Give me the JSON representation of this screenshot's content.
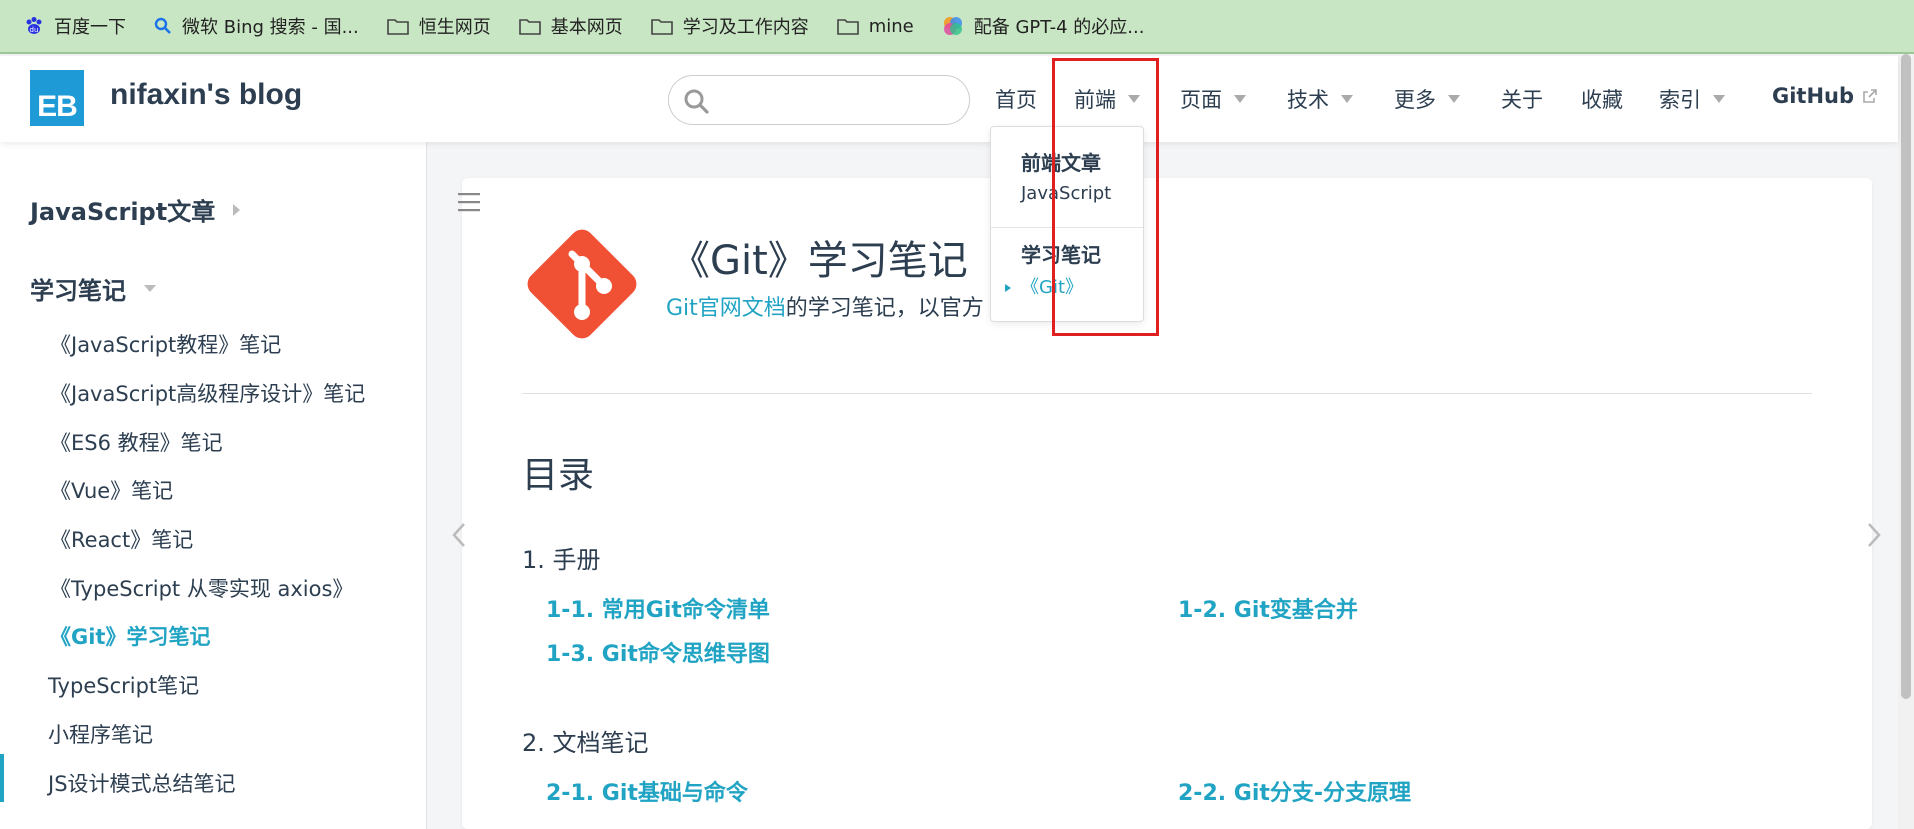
{
  "bookmarks": [
    {
      "label": "百度一下",
      "icon": "baidu-paw-icon"
    },
    {
      "label": "微软 Bing 搜索 - 国...",
      "icon": "bing-search-icon"
    },
    {
      "label": "恒生网页",
      "icon": "folder-icon"
    },
    {
      "label": "基本网页",
      "icon": "folder-icon"
    },
    {
      "label": "学习及工作内容",
      "icon": "folder-icon"
    },
    {
      "label": "mine",
      "icon": "folder-icon"
    },
    {
      "label": "配备 GPT-4 的必应...",
      "icon": "copilot-icon"
    }
  ],
  "navbar": {
    "logo_text": "EB",
    "site_title": "nifaxin's blog",
    "search_placeholder": "",
    "items": [
      {
        "label": "首页",
        "dropdown": false
      },
      {
        "label": "前端",
        "dropdown": true
      },
      {
        "label": "页面",
        "dropdown": true
      },
      {
        "label": "技术",
        "dropdown": true
      },
      {
        "label": "更多",
        "dropdown": true
      },
      {
        "label": "关于",
        "dropdown": false
      },
      {
        "label": "收藏",
        "dropdown": false
      },
      {
        "label": "索引",
        "dropdown": true
      },
      {
        "label": "GitHub",
        "dropdown": false,
        "external": true
      }
    ]
  },
  "dropdown": {
    "groups": [
      {
        "heading": "前端文章",
        "items": [
          "JavaScript"
        ]
      },
      {
        "heading": "学习笔记",
        "items": [
          "《Git》"
        ]
      }
    ]
  },
  "sidebar": {
    "groups": [
      {
        "title": "JavaScript文章",
        "expanded": false
      },
      {
        "title": "学习笔记",
        "expanded": true
      }
    ],
    "items": [
      "《JavaScript教程》笔记",
      "《JavaScript高级程序设计》笔记",
      "《ES6 教程》笔记",
      "《Vue》笔记",
      "《React》笔记",
      "《TypeScript 从零实现 axios》",
      "《Git》学习笔记",
      "TypeScript笔记",
      "小程序笔记",
      "JS设计模式总结笔记"
    ],
    "active_index": 6
  },
  "page": {
    "title": "《Git》学习笔记",
    "desc_link": "Git官网文档",
    "desc_text": "的学习笔记，以官方",
    "toc_title": "目录",
    "sections": [
      {
        "title": "1. 手册",
        "links": [
          "1-1. 常用Git命令清单",
          "1-2. Git变基合并",
          "1-3. Git命令思维导图"
        ]
      },
      {
        "title": "2. 文档笔记",
        "links": [
          "2-1. Git基础与命令",
          "2-2. Git分支-分支原理"
        ]
      }
    ]
  },
  "colors": {
    "accent": "#21a4c4",
    "highlight": "#e02020",
    "git": "#f05033"
  }
}
